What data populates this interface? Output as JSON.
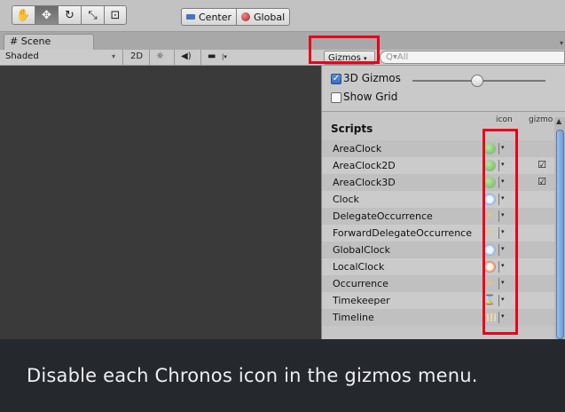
{
  "toolbar": {
    "tools": [
      {
        "name": "hand-tool",
        "glyph": "✋"
      },
      {
        "name": "move-tool",
        "glyph": "✥"
      },
      {
        "name": "rotate-tool",
        "glyph": "↻"
      },
      {
        "name": "scale-tool",
        "glyph": "⤡"
      },
      {
        "name": "rect-tool",
        "glyph": "⊡"
      }
    ],
    "pivot_label": "Center",
    "space_label": "Global"
  },
  "tabs": {
    "scene_label": "# Scene"
  },
  "scenebar": {
    "shading_mode": "Shaded",
    "mode_2d": "2D",
    "gizmos_label": "Gizmos",
    "search_placeholder": "Q▾All"
  },
  "gizmos_panel": {
    "gizmos_3d_label": "3D Gizmos",
    "show_grid_label": "Show Grid",
    "section_title": "Scripts",
    "col_icon": "icon",
    "col_gizmo": "gizmo",
    "scripts": [
      {
        "name": "AreaClock",
        "icon": "green",
        "gizmo": false
      },
      {
        "name": "AreaClock2D",
        "icon": "green",
        "gizmo": true
      },
      {
        "name": "AreaClock3D",
        "icon": "green",
        "gizmo": true
      },
      {
        "name": "Clock",
        "icon": "clock",
        "gizmo": false
      },
      {
        "name": "DelegateOccurrence",
        "icon": "bolt",
        "gizmo": false
      },
      {
        "name": "ForwardDelegateOccurrence",
        "icon": "bolt",
        "gizmo": false
      },
      {
        "name": "GlobalClock",
        "icon": "clock",
        "gizmo": false
      },
      {
        "name": "LocalClock",
        "icon": "clock-red",
        "gizmo": false
      },
      {
        "name": "Occurrence",
        "icon": "bolt",
        "gizmo": false
      },
      {
        "name": "Timekeeper",
        "icon": "hour",
        "gizmo": false
      },
      {
        "name": "Timeline",
        "icon": "film",
        "gizmo": false
      }
    ]
  },
  "caption": "Disable each Chronos icon in the gizmos menu.",
  "colors": {
    "highlight": "#e8001b",
    "caption_bg": "#25282d",
    "viewport_bg": "#3a3a3a"
  }
}
